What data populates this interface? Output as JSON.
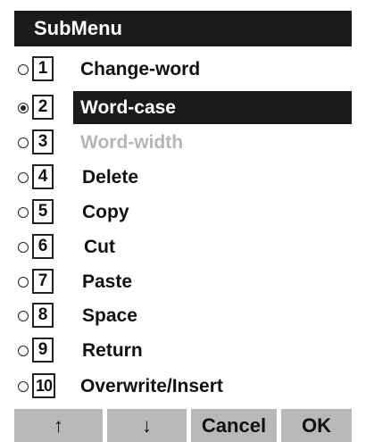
{
  "title": "SubMenu",
  "items": [
    {
      "number": "1",
      "label": "Change-word",
      "selected": false,
      "disabled": false
    },
    {
      "number": "2",
      "label": "Word-case",
      "selected": true,
      "disabled": false
    },
    {
      "number": "3",
      "label": "Word-width",
      "selected": false,
      "disabled": true
    },
    {
      "number": "4",
      "label": "Delete",
      "selected": false,
      "disabled": false
    },
    {
      "number": "5",
      "label": "Copy",
      "selected": false,
      "disabled": false
    },
    {
      "number": "6",
      "label": "Cut",
      "selected": false,
      "disabled": false
    },
    {
      "number": "7",
      "label": "Paste",
      "selected": false,
      "disabled": false
    },
    {
      "number": "8",
      "label": "Space",
      "selected": false,
      "disabled": false
    },
    {
      "number": "9",
      "label": "Return",
      "selected": false,
      "disabled": false
    },
    {
      "number": "10",
      "label": "Overwrite/Insert",
      "selected": false,
      "disabled": false
    }
  ],
  "softkeys": {
    "up": "↑",
    "down": "↓",
    "cancel": "Cancel",
    "ok": "OK"
  },
  "colors": {
    "title_bg": "#1b1b1b",
    "selected_bg": "#1b1b1b",
    "disabled_text": "#b5b5b5",
    "softkey_bg": "#b8b8b8"
  }
}
